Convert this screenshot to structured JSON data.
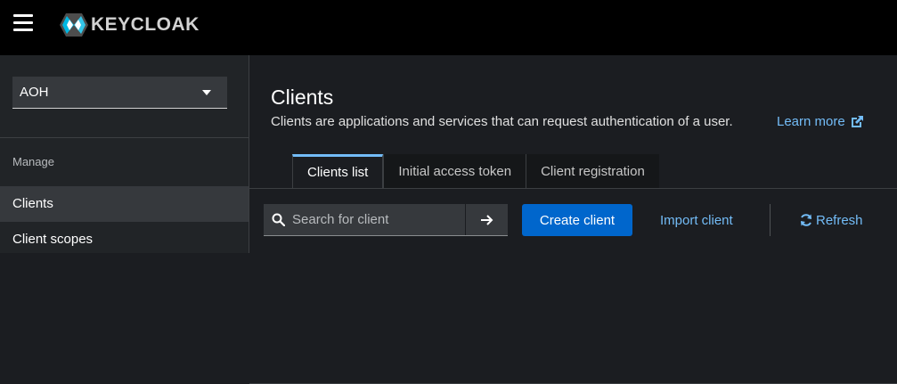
{
  "header": {
    "brand_text": "KEYCLOAK",
    "menu_icon": "hamburger-icon",
    "logo_icon": "keycloak-logo-icon"
  },
  "sidebar": {
    "realm": "AOH",
    "section_title": "Manage",
    "items": [
      {
        "label": "Clients",
        "active": true
      },
      {
        "label": "Client scopes",
        "active": false
      }
    ]
  },
  "main": {
    "title": "Clients",
    "description": "Clients are applications and services that can request authentication of a user.",
    "learn_more": "Learn more",
    "tabs": [
      {
        "label": "Clients list",
        "active": true
      },
      {
        "label": "Initial access token",
        "active": false
      },
      {
        "label": "Client registration",
        "active": false
      }
    ],
    "toolbar": {
      "search_placeholder": "Search for client",
      "create_label": "Create client",
      "import_label": "Import client",
      "refresh_label": "Refresh"
    }
  },
  "colors": {
    "accent": "#0066cc",
    "link": "#73bcf7",
    "masthead": "#000000",
    "background": "#1b1d21"
  }
}
